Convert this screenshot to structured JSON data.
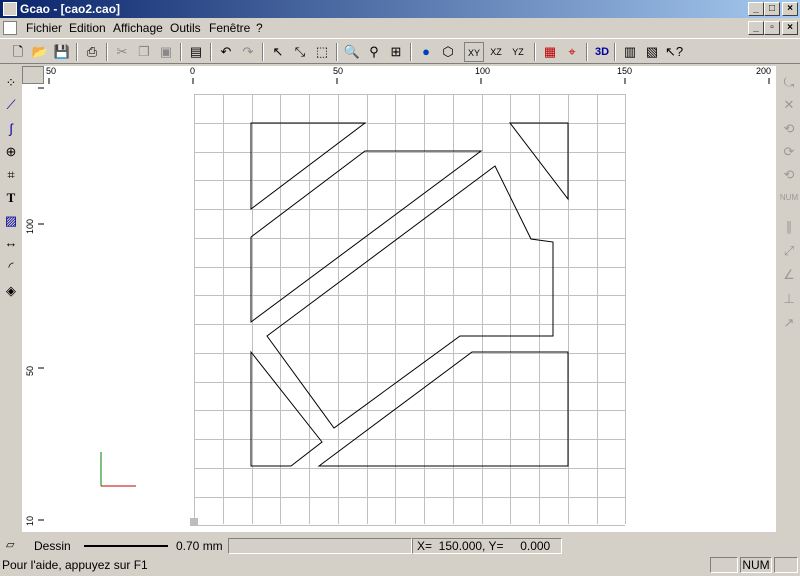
{
  "window": {
    "title": "Gcao - [cao2.cao]"
  },
  "menu": [
    "Fichier",
    "Edition",
    "Affichage",
    "Outils",
    "Fenêtre",
    "?"
  ],
  "rulers": {
    "h_ticks": [
      "50",
      "0",
      "50",
      "100",
      "150",
      "200"
    ],
    "v_ticks": [
      "100",
      "50",
      "10"
    ]
  },
  "status": {
    "mode_label": "Dessin",
    "line_width": "0.70 mm",
    "coord_label": "X=  150.000, Y=     0.000",
    "help": "Pour l'aide, appuyez sur F1",
    "num_indicator": "NUM"
  },
  "toolbar": {
    "view3d_label": "3D"
  },
  "icons": {
    "top": [
      "new-icon",
      "open-icon",
      "save-icon",
      "print-icon",
      "cut-icon",
      "copy-icon",
      "paste-icon",
      "properties-icon",
      "undo-icon",
      "redo-icon",
      "select-arrow-icon",
      "select-node-icon",
      "zoom-window-icon",
      "zoom-icon",
      "zoom-fit-icon",
      "zoom-all-icon",
      "globe-icon",
      "cube-icon",
      "view-xy-icon",
      "view-xz-icon",
      "view-yz-icon",
      "layer-icon",
      "snap-icon",
      "view-3d-icon",
      "print-preview-icon",
      "export-3d-icon",
      "help-pointer-icon"
    ],
    "left": [
      "points-icon",
      "polyline-icon",
      "curve-icon",
      "circle-icon",
      "rect-transform-icon",
      "text-icon",
      "hatch-icon",
      "dimension-icon",
      "arc-icon",
      "fill-icon"
    ],
    "right": [
      "transform-icon",
      "scale-icon",
      "rotate-x-icon",
      "rotate-y-icon",
      "rotate-z-icon",
      "rotate-num-icon",
      "parallel-icon",
      "distance-icon",
      "angle-icon",
      "perpendicular-icon",
      "tangent-icon"
    ]
  },
  "colors": {
    "axis_x": "#c00000",
    "axis_y": "#008000",
    "grid": "#c0c0c0",
    "title_start": "#0a246a",
    "title_end": "#a6caf0"
  }
}
